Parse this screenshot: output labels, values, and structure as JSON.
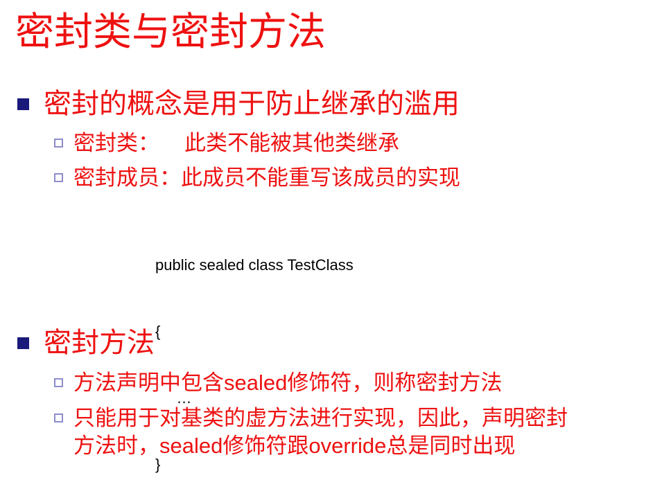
{
  "slide": {
    "title": "密封类与密封方法",
    "colors": {
      "text": "#ee1111",
      "bullet_primary": "#1a1a7a",
      "bullet_secondary": "#8c8ccc",
      "code": "#000000",
      "background": "#ffffff"
    },
    "section1": {
      "heading": "密封的概念是用于防止继承的滥用",
      "items": [
        {
          "label": "密封类：",
          "text": "此类不能被其他类继承"
        },
        {
          "label": "密封成员：",
          "text": "此成员不能重写该成员的实现"
        }
      ],
      "code": {
        "lines": [
          "public sealed class TestClass",
          "{",
          "     …",
          "}"
        ]
      }
    },
    "section2": {
      "heading": "密封方法",
      "item1": {
        "before": "方法声明中包含",
        "keyword": "sealed",
        "after": "修饰符，则称密封方法"
      },
      "item2": {
        "line1": "只能用于对基类的虚方法进行实现，因此，声明密封",
        "prefix": "方法时，",
        "keyword1": "sealed",
        "middle": "修饰符跟",
        "keyword2": "override",
        "suffix": "总是同时出现"
      }
    }
  }
}
